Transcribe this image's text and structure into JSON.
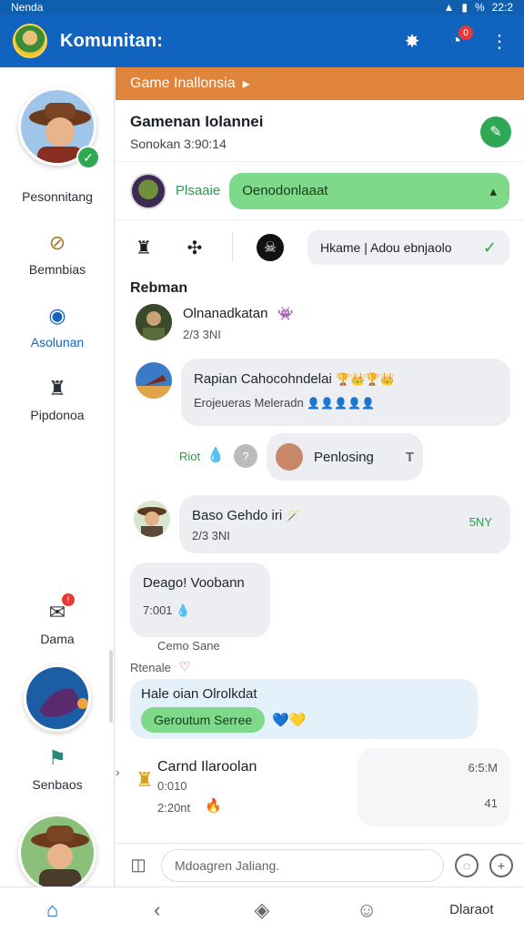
{
  "status": {
    "carrier": "Nenda",
    "battery": "%",
    "time": "22:2"
  },
  "app": {
    "title": "Komunitan:"
  },
  "sidebar": {
    "items": [
      {
        "label": "Pesonnitang"
      },
      {
        "label": "Bemnbias"
      },
      {
        "label": "Asolunan"
      },
      {
        "label": "Pipdonoa"
      },
      {
        "label": "Dama",
        "badge": "!"
      },
      {
        "label": "Senbaos"
      }
    ]
  },
  "banner": {
    "label": "Game  Inallonsia"
  },
  "game": {
    "title": "Gamenan Iolannei",
    "subtitle": "Sonokan  3:90:14"
  },
  "pinned": {
    "label": "Plsaaie",
    "message": "Oenodonlaaat"
  },
  "tools": {
    "search_text": "Hkame | Adou ebnjaolo"
  },
  "section": {
    "label": "Rebman"
  },
  "messages": [
    {
      "name": "Olnanadkatan",
      "time": "2/3 3NI"
    },
    {
      "name": "Rapian Cahocohndelai",
      "sub": "Erojeueras",
      "sub2": "Meleradn"
    },
    {
      "left_label": "Riot",
      "text": "Penlosing"
    },
    {
      "name": "Baso Gehdo iri",
      "time": "2/3 3NI",
      "tag": "5NY"
    },
    {
      "name": "Deago! Voobann",
      "time": "7:001"
    },
    {
      "caption": "Cemo Sane"
    },
    {
      "label": "Rtenale",
      "title": "Hale oian Olrolkdat",
      "button": "Geroutum Serree"
    },
    {
      "title": "Carnd Ilaroolan",
      "sub": "0:010",
      "time": "2:20nt",
      "right_time": "6:5:M",
      "right_num": "41"
    }
  ],
  "composer": {
    "placeholder": "Mdoagren Jaliang."
  },
  "bottomnav": {
    "label": "Dlaraot"
  },
  "colors": {
    "primary": "#1064bf",
    "accent_orange": "#e0833b",
    "green": "#2ea853"
  }
}
